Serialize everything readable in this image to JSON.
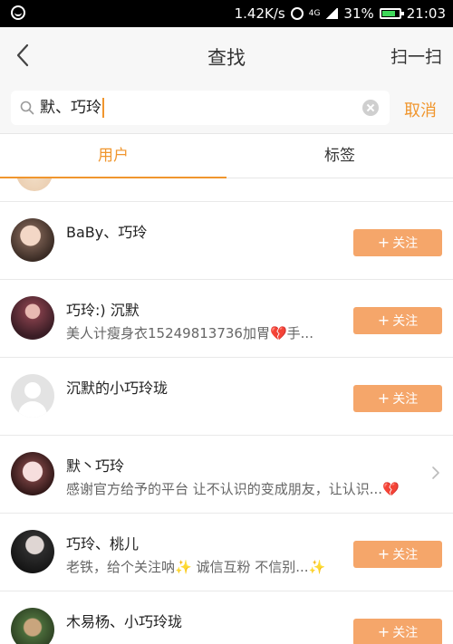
{
  "status_bar": {
    "speed": "1.42K/s",
    "network": "4G",
    "battery": "31%",
    "time": "21:03"
  },
  "header": {
    "title": "查找",
    "scan_label": "扫一扫"
  },
  "search": {
    "value": "默、巧玲",
    "cancel_label": "取消"
  },
  "tabs": [
    {
      "label": "用户",
      "active": true
    },
    {
      "label": "标签",
      "active": false
    }
  ],
  "results": [
    {
      "name": "BaBy、巧玲",
      "bio": "",
      "action": "关注"
    },
    {
      "name": "巧玲:) 沉默",
      "bio": "美人计瘦身衣15249813736加胃💔手...",
      "action": "关注"
    },
    {
      "name": "沉默的小巧玲珑",
      "bio": "",
      "action": "关注"
    },
    {
      "name": "默丶巧玲",
      "bio": "感谢官方给予的平台 让不认识的变成朋友，让认识...💔",
      "action": ""
    },
    {
      "name": "巧玲、桃儿",
      "bio": "老铁，给个关注呐✨ 诚信互粉 不信别...✨",
      "action": "关注"
    },
    {
      "name": "木易杨、小巧玲珑",
      "bio": "",
      "action": "关注"
    }
  ],
  "colors": {
    "accent": "#f0962e",
    "follow_bg": "#f5a66a"
  }
}
